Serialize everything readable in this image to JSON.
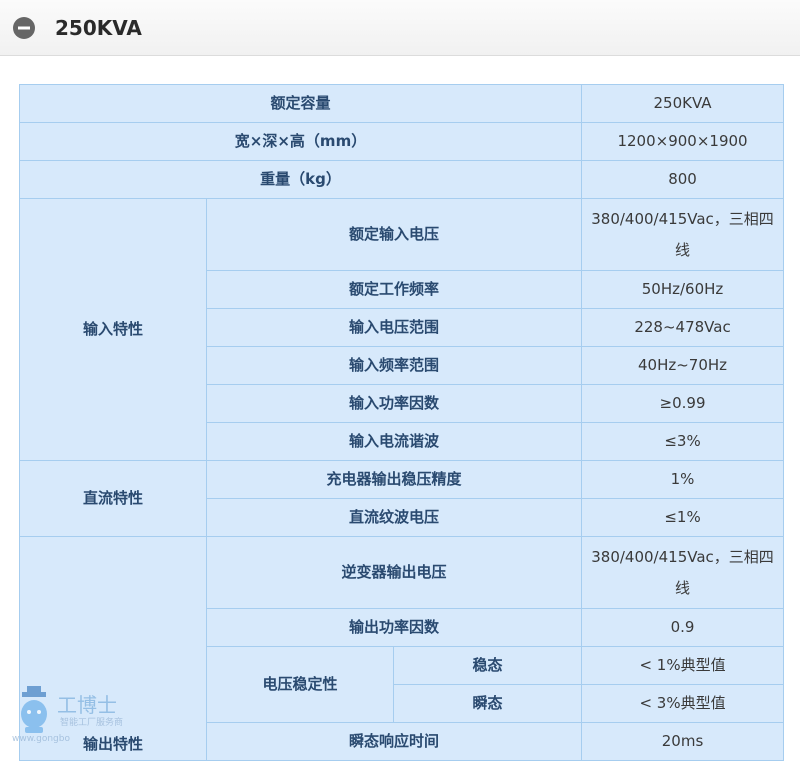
{
  "header": {
    "title": "250KVA",
    "collapse_icon": "minus-circle-icon"
  },
  "table": {
    "rated_capacity": {
      "label": "额定容量",
      "value": "250KVA"
    },
    "dimensions": {
      "label": "宽×深×高（mm）",
      "value": "1200×900×1900"
    },
    "weight": {
      "label": "重量（kg）",
      "value": "800"
    },
    "input": {
      "group": "输入特性",
      "rated_voltage": {
        "label": "额定输入电压",
        "value": "380/400/415Vac，三相四线"
      },
      "rated_frequency": {
        "label": "额定工作频率",
        "value": "50Hz/60Hz"
      },
      "voltage_range": {
        "label": "输入电压范围",
        "value": "228~478Vac"
      },
      "frequency_range": {
        "label": "输入频率范围",
        "value": "40Hz~70Hz"
      },
      "power_factor": {
        "label": "输入功率因数",
        "value": "≥0.99"
      },
      "current_harmonic": {
        "label": "输入电流谐波",
        "value": "≤3%"
      }
    },
    "dc": {
      "group": "直流特性",
      "charger_accuracy": {
        "label": "充电器输出稳压精度",
        "value": "1%"
      },
      "ripple_voltage": {
        "label": "直流纹波电压",
        "value": "≤1%"
      }
    },
    "output": {
      "group": "输出特性",
      "inverter_voltage": {
        "label": "逆变器输出电压",
        "value": "380/400/415Vac，三相四线"
      },
      "power_factor": {
        "label": "输出功率因数",
        "value": "0.9"
      },
      "voltage_stability": {
        "label": "电压稳定性",
        "steady": {
          "label": "稳态",
          "value": "< 1%典型值"
        },
        "transient": {
          "label": "瞬态",
          "value": "< 3%典型值"
        }
      },
      "response_time": {
        "label": "瞬态响应时间",
        "value": "20ms"
      }
    }
  },
  "watermark": {
    "brand": "工博士",
    "slogan": "智能工厂服务商",
    "url": "www.gongbo"
  }
}
